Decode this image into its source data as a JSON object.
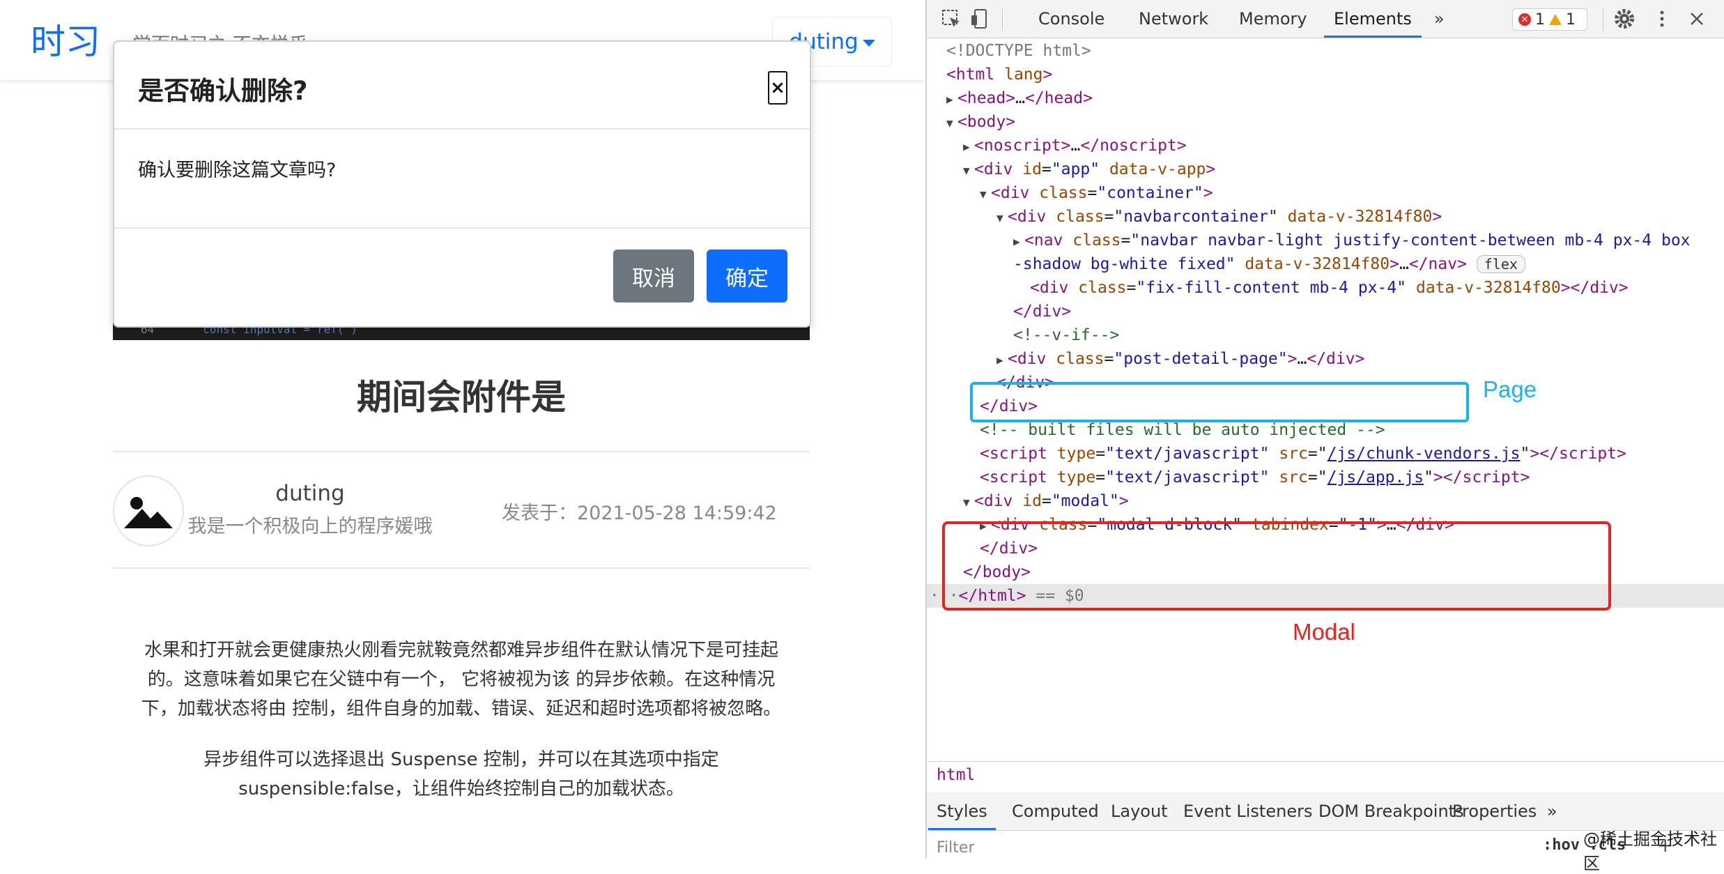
{
  "page": {
    "brand": "时习",
    "slogan": "学而时习之 不亦悦乎",
    "user_menu": "duting",
    "cover_code": {
      "line_no": "64",
      "code": "const inputVal = ref( )"
    },
    "post_title": "期间会附件是",
    "author": {
      "name": "duting",
      "description": "我是一个积极向上的程序媛哦"
    },
    "publish_time": "发表于：2021-05-28 14:59:42",
    "paragraphs": [
      [
        "水果和打开就会更健康热火刚看完就鞍竟然都难异步组件在默认情况下是可挂起",
        "的。这意味着如果它在父链中有一个， 它将被视为该 的异步依赖。在这种情况",
        "下，加载状态将由 控制，组件自身的加载、错误、延迟和超时选项都将被忽略。"
      ],
      [
        "异步组件可以选择退出 Suspense 控制，并可以在其选项中指定",
        "suspensible:false，让组件始终控制自己的加载状态。"
      ]
    ]
  },
  "modal": {
    "title": "是否确认删除?",
    "close": "×",
    "body": "确认要删除这篇文章吗?",
    "cancel": "取消",
    "confirm": "确定"
  },
  "devtools": {
    "tabs": [
      "Console",
      "Network",
      "Memory",
      "Elements"
    ],
    "active_tab": "Elements",
    "more": "»",
    "errors": "1",
    "warnings": "1",
    "dom": {
      "doctype": "<!DOCTYPE html>",
      "html_open": "html",
      "lang_attr": "lang",
      "head": "head",
      "body": "body",
      "noscript": "noscript",
      "div": "div",
      "nav": "nav",
      "id": "id",
      "class": "class",
      "app_id": "\"app\"",
      "data_v_app": "data-v-app",
      "container": "\"container\"",
      "navbarcontainer": "\"navbarcontainer\"",
      "data_v": "data-v-32814f80",
      "nav_class_1": "\"navbar navbar-light justify-content-between mb-4 px-4 box",
      "nav_class_2": "-shadow bg-white fixed\"",
      "flex_badge": "flex",
      "fix_fill_class": "\"fix-fill-content mb-4 px-4\"",
      "v_if_comment": "<!--v-if-->",
      "post_detail_class": "\"post-detail-page\"",
      "built_comment": "<!-- built files will be auto injected -->",
      "script": "script",
      "type": "type",
      "type_val": "\"text/javascript\"",
      "src": "src",
      "chunk_vendors": "/js/chunk-vendors.js",
      "app_js": "/js/app.js",
      "modal_id": "\"modal\"",
      "modal_class": "\"modal d-block\"",
      "tabindex": "tabindex",
      "tabindex_val": "\"-1\"",
      "html_close_suffix": " == $0"
    },
    "annotations": {
      "page": "Page",
      "modal": "Modal"
    },
    "breadcrumb": "html",
    "panel_tabs": [
      "Styles",
      "Computed",
      "Layout",
      "Event Listeners",
      "DOM Breakpoints",
      "Properties"
    ],
    "panel_more": "»",
    "filter_placeholder": "Filter",
    "hov_cls": ":hov  .cls",
    "add": "+"
  },
  "watermark": "@稀土掘金技术社区"
}
